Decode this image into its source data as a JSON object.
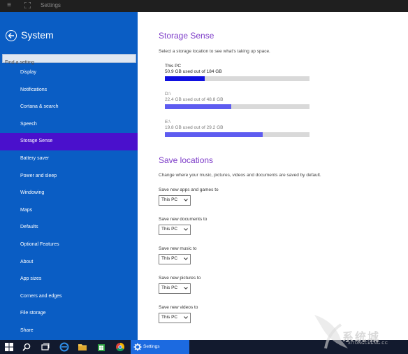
{
  "titlebar": {
    "title": "Settings"
  },
  "sidebar": {
    "title": "System",
    "search_placeholder": "Find a setting",
    "items": [
      {
        "label": "Display"
      },
      {
        "label": "Notifications"
      },
      {
        "label": "Cortana & search"
      },
      {
        "label": "Speech"
      },
      {
        "label": "Storage Sense",
        "active": true
      },
      {
        "label": "Battery saver"
      },
      {
        "label": "Power and sleep"
      },
      {
        "label": "Windowing"
      },
      {
        "label": "Maps"
      },
      {
        "label": "Defaults"
      },
      {
        "label": "Optional Features"
      },
      {
        "label": "About"
      },
      {
        "label": "App sizes"
      },
      {
        "label": "Corners and edges"
      },
      {
        "label": "File storage"
      },
      {
        "label": "Share"
      }
    ]
  },
  "storage": {
    "heading": "Storage Sense",
    "description": "Select a storage location to see what's taking up space.",
    "drives": [
      {
        "name": "This PC",
        "usage": "50.9 GB used out of 184 GB",
        "fraction": 0.277,
        "color": "#1010e0"
      },
      {
        "name": "D:\\",
        "usage": "22.4 GB used out of 48.8 GB",
        "fraction": 0.459,
        "color": "#5e5cf0"
      },
      {
        "name": "E:\\",
        "usage": "19.8 GB used out of 29.2 GB",
        "fraction": 0.678,
        "color": "#5e5cf0"
      }
    ]
  },
  "save_locations": {
    "heading": "Save locations",
    "description": "Change where your music, pictures, videos and documents are saved by default.",
    "rows": [
      {
        "label": "Save new apps and games to",
        "value": "This PC"
      },
      {
        "label": "Save new documents to",
        "value": "This PC"
      },
      {
        "label": "Save new music to",
        "value": "This PC"
      },
      {
        "label": "Save new pictures to",
        "value": "This PC"
      },
      {
        "label": "Save new videos to",
        "value": "This PC"
      }
    ]
  },
  "taskbar": {
    "active_app": "Settings",
    "icons": [
      "start-icon",
      "search-icon",
      "task-view-icon",
      "edge-icon",
      "file-explorer-icon",
      "store-icon",
      "chrome-icon",
      "settings-gear-icon"
    ]
  },
  "watermark": {
    "text": "系统城",
    "sub": "XITONGCHENG.CC"
  },
  "colors": {
    "sidebar": "#0a5dc4",
    "active_item": "#4a10cc",
    "heading": "#7d3cc8",
    "taskbar": "#121a2e"
  }
}
